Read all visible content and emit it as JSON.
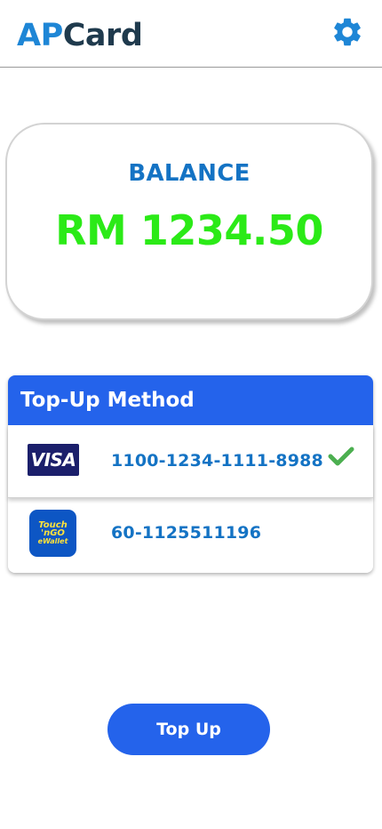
{
  "header": {
    "logo_part1": "AP",
    "logo_part2": "Card",
    "settings_icon": "gear-icon",
    "accent_color": "#1e86d6"
  },
  "balance": {
    "label": "BALANCE",
    "amount": "RM 1234.50",
    "amount_color": "#2bea17"
  },
  "topup_methods": {
    "title": "Top-Up Method",
    "header_color": "#2463eb",
    "items": [
      {
        "logo_text": "VISA",
        "logo_icon": "visa-card-icon",
        "number": "1100-1234-1111-8988",
        "selected": true,
        "selected_icon": "check-icon"
      },
      {
        "logo_lines": [
          "Touch",
          "'nGO",
          "eWallet"
        ],
        "logo_icon": "touch-n-go-ewallet-icon",
        "number": "60-1125511196",
        "selected": false
      }
    ]
  },
  "actions": {
    "topup_label": "Top Up"
  }
}
